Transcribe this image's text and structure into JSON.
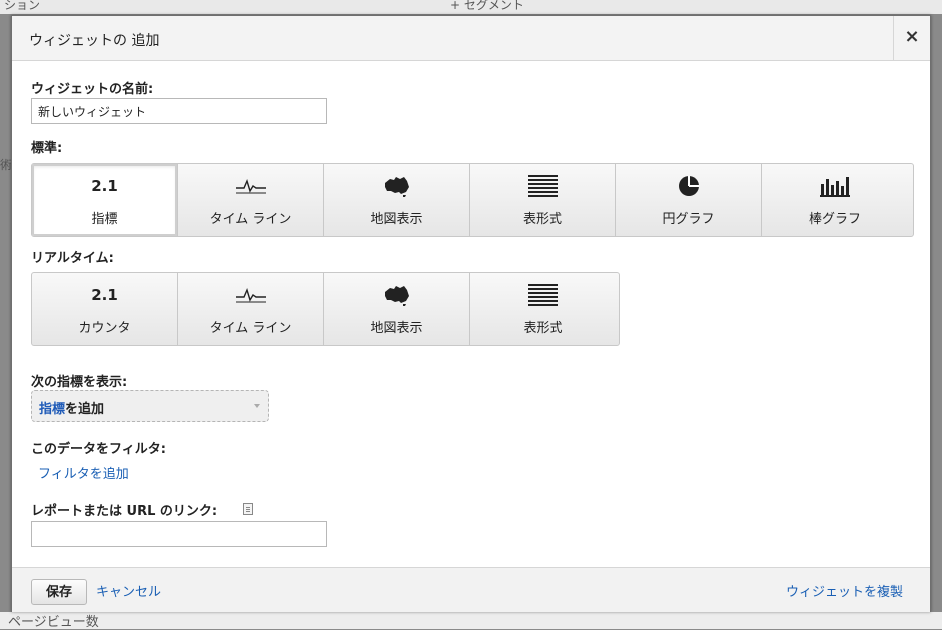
{
  "background": {
    "top_left_text": "ション",
    "top_center_text": "+ セグメント",
    "left_text": "術",
    "bottom_text": "ページビュー数"
  },
  "dialog": {
    "title": "ウィジェットの 追加",
    "close_glyph": "×",
    "name_label": "ウィジェットの名前:",
    "name_value": "新しいウィジェット",
    "standard_label": "標準:",
    "standard_tiles": [
      {
        "icon": "metric-number",
        "icon_text": "2.1",
        "label": "指標",
        "selected": true
      },
      {
        "icon": "timeline-icon",
        "label": "タイム ライン"
      },
      {
        "icon": "map-icon",
        "label": "地図表示"
      },
      {
        "icon": "table-icon",
        "label": "表形式"
      },
      {
        "icon": "pie-chart-icon",
        "label": "円グラフ"
      },
      {
        "icon": "bar-chart-icon",
        "label": "棒グラフ"
      }
    ],
    "realtime_label": "リアルタイム:",
    "realtime_tiles": [
      {
        "icon": "counter-number",
        "icon_text": "2.1",
        "label": "カウンタ"
      },
      {
        "icon": "timeline-icon",
        "label": "タイム ライン"
      },
      {
        "icon": "map-icon",
        "label": "地図表示"
      },
      {
        "icon": "table-icon",
        "label": "表形式"
      }
    ],
    "show_metric_label": "次の指標を表示:",
    "metric_dropdown_blue": "指標",
    "metric_dropdown_rest": "を追加",
    "filter_label": "このデータをフィルタ:",
    "add_filter_link": "フィルタを追加",
    "link_label": "レポートまたは URL のリンク:",
    "link_value": "",
    "footer": {
      "save_label": "保存",
      "cancel_label": "キャンセル",
      "copy_label": "ウィジェットを複製"
    },
    "accent_color": "#1a5fb4"
  }
}
